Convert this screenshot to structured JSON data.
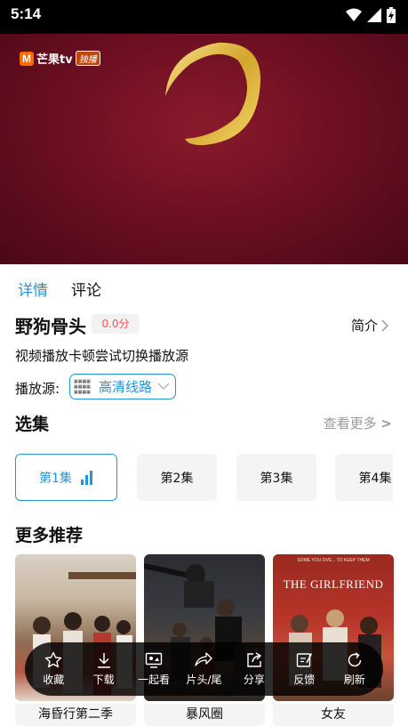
{
  "status": {
    "time": "5:14"
  },
  "video": {
    "logo_text": "芒果tv",
    "logo_badge": "独播",
    "logo_mark": "M"
  },
  "tabs": [
    {
      "label": "详情"
    },
    {
      "label": "评论"
    }
  ],
  "show": {
    "title": "野狗骨头",
    "score": "0.0分",
    "intro_label": "简介",
    "hint": "视频播放卡顿尝试切换播放源",
    "source_label": "播放源:",
    "source_value": "高清线路"
  },
  "episodes_section": {
    "title": "选集",
    "more_label": "查看更多"
  },
  "episodes": [
    {
      "label": "第1集"
    },
    {
      "label": "第2集"
    },
    {
      "label": "第3集"
    },
    {
      "label": "第4集"
    }
  ],
  "recommend_section": {
    "title": "更多推荐"
  },
  "recommendations": [
    {
      "title": "海昏行第二季"
    },
    {
      "title": "暴风圈"
    },
    {
      "title": "女友",
      "poster_text": "THE GIRLFRIEND",
      "poster_small_text": "SOME YOU OVE... TO KEEP THEM"
    }
  ],
  "toolbar": [
    {
      "label": "收藏",
      "icon": "star-icon"
    },
    {
      "label": "下载",
      "icon": "download-icon"
    },
    {
      "label": "一起看",
      "icon": "screen-icon"
    },
    {
      "label": "片头/尾",
      "icon": "skip-icon"
    },
    {
      "label": "分享",
      "icon": "share-icon"
    },
    {
      "label": "反馈",
      "icon": "feedback-icon"
    },
    {
      "label": "刷新",
      "icon": "refresh-icon"
    }
  ],
  "colors": {
    "accent": "#2196d9",
    "score": "#ff5252",
    "video_bg": "#6e1022"
  }
}
